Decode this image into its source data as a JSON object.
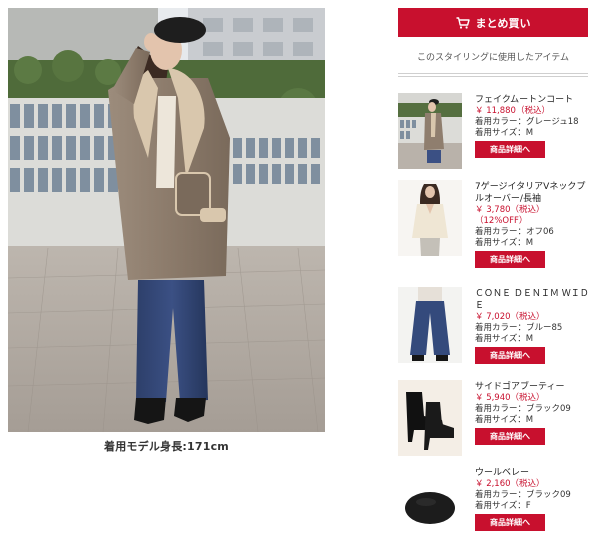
{
  "header": {
    "bulk_buy_label": "まとめ買い",
    "section_heading": "このスタイリングに使用したアイテム"
  },
  "main_photo": {
    "caption": "着用モデル身長:171cm"
  },
  "items": [
    {
      "name": "フェイクムートンコート",
      "price": "￥ 11,880（税込）",
      "color": "着用カラー：グレージュ18",
      "size": "着用サイズ：M",
      "button": "商品詳細へ"
    },
    {
      "name": "7ゲージイタリアVネックプルオーバー/長袖",
      "price": "￥ 3,780（税込）",
      "discount": "（12%OFF）",
      "color": "着用カラー：オフ06",
      "size": "着用サイズ：M",
      "button": "商品詳細へ"
    },
    {
      "name": "ＣＯＮＥ ＤＥＮＩＭ ＷＩＤＥ",
      "price": "￥ 7,020（税込）",
      "color": "着用カラー：ブルー85",
      "size": "着用サイズ：M",
      "button": "商品詳細へ"
    },
    {
      "name": "サイドゴアブーティー",
      "price": "￥ 5,940（税込）",
      "color": "着用カラー：ブラック09",
      "size": "着用サイズ：M",
      "button": "商品詳細へ"
    },
    {
      "name": "ウールベレー",
      "price": "￥ 2,160（税込）",
      "color": "着用カラー：ブラック09",
      "size": "着用サイズ：F",
      "button": "商品詳細へ"
    }
  ],
  "icons": {
    "cart": "cart-icon"
  },
  "colors": {
    "accent": "#c8102e"
  }
}
